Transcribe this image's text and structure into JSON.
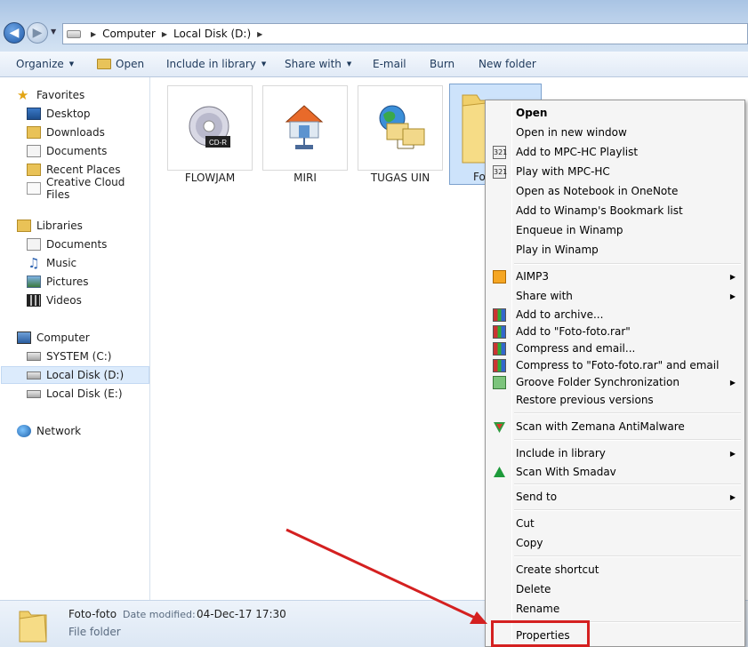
{
  "address": {
    "crumbs": [
      "Computer",
      "Local Disk (D:)"
    ]
  },
  "toolbar": {
    "organize": "Organize",
    "open": "Open",
    "include_in_library": "Include in library",
    "share_with": "Share with",
    "email": "E-mail",
    "burn": "Burn",
    "new_folder": "New folder"
  },
  "navpane": {
    "favorites": "Favorites",
    "desktop": "Desktop",
    "downloads": "Downloads",
    "documents": "Documents",
    "recent_places": "Recent Places",
    "creative_cloud": "Creative Cloud Files",
    "libraries": "Libraries",
    "lib_documents": "Documents",
    "music": "Music",
    "pictures": "Pictures",
    "videos": "Videos",
    "computer": "Computer",
    "system_c": "SYSTEM (C:)",
    "local_d": "Local Disk (D:)",
    "local_e": "Local Disk (E:)",
    "network": "Network"
  },
  "files": [
    {
      "name": "FLOWJAM",
      "icon": "cd-drive-icon",
      "badge": "CD-R"
    },
    {
      "name": "MIRI",
      "icon": "home-network-icon"
    },
    {
      "name": "TUGAS UIN",
      "icon": "network-globe-icon"
    },
    {
      "name": "Fo",
      "icon": "folder-icon"
    }
  ],
  "status": {
    "name": "Foto-foto",
    "date_key": "Date modified:",
    "date_val": "04-Dec-17 17:30",
    "type": "File folder"
  },
  "context_menu": {
    "open": "Open",
    "open_new_window": "Open in new window",
    "add_mpc_playlist": "Add to MPC-HC Playlist",
    "play_mpc": "Play with MPC-HC",
    "open_onenote": "Open as Notebook in OneNote",
    "add_winamp_bookmark": "Add to Winamp's Bookmark list",
    "enqueue_winamp": "Enqueue in Winamp",
    "play_winamp": "Play in Winamp",
    "aimp3": "AIMP3",
    "share_with": "Share with",
    "add_archive": "Add to archive...",
    "add_rar": "Add to \"Foto-foto.rar\"",
    "compress_email": "Compress and email...",
    "compress_rar_email": "Compress to \"Foto-foto.rar\" and email",
    "groove_sync": "Groove Folder Synchronization",
    "restore_versions": "Restore previous versions",
    "scan_zemana": "Scan with Zemana AntiMalware",
    "include_library": "Include in library",
    "scan_smadav": "Scan With Smadav",
    "send_to": "Send to",
    "cut": "Cut",
    "copy": "Copy",
    "create_shortcut": "Create shortcut",
    "delete": "Delete",
    "rename": "Rename",
    "properties": "Properties"
  },
  "colors": {
    "annotation_red": "#d42020",
    "selection_blue": "#cde3fb"
  }
}
